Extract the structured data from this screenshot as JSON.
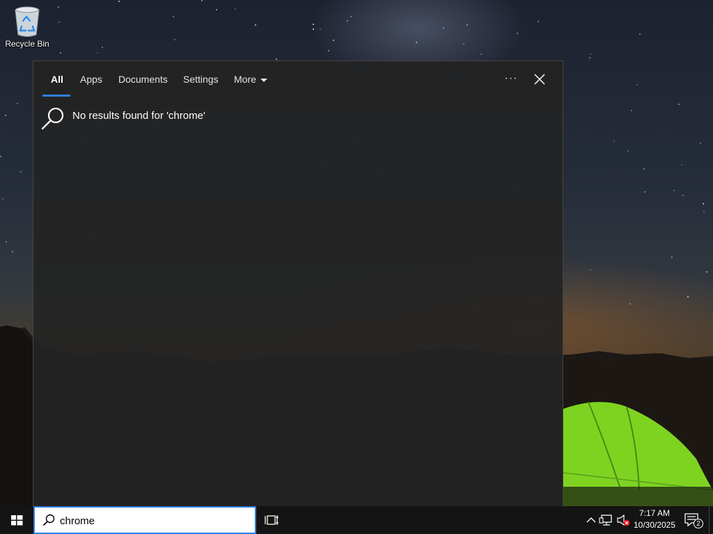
{
  "desktop": {
    "icons": [
      {
        "label": "Recycle Bin",
        "icon": "recycle-bin-icon"
      }
    ]
  },
  "search_panel": {
    "tabs": [
      {
        "label": "All",
        "active": true
      },
      {
        "label": "Apps",
        "active": false
      },
      {
        "label": "Documents",
        "active": false
      },
      {
        "label": "Settings",
        "active": false
      },
      {
        "label": "More",
        "active": false
      }
    ],
    "options_label": "···",
    "options_icon": "more-options-icon",
    "close_icon": "close-icon",
    "no_results_text": "No results found for 'chrome'",
    "no_results_icon": "search-icon",
    "accent_color": "#2f7fe0"
  },
  "taskbar": {
    "start_icon": "windows-logo-icon",
    "search": {
      "value": "chrome",
      "icon": "search-icon"
    },
    "task_view_icon": "task-view-icon",
    "tray": {
      "icons": [
        "chevron-up-icon",
        "network-icon",
        "volume-muted-icon"
      ],
      "time": "7:17 AM",
      "date": "10/30/2025",
      "notification_count": "2",
      "notification_icon": "action-center-icon"
    }
  }
}
